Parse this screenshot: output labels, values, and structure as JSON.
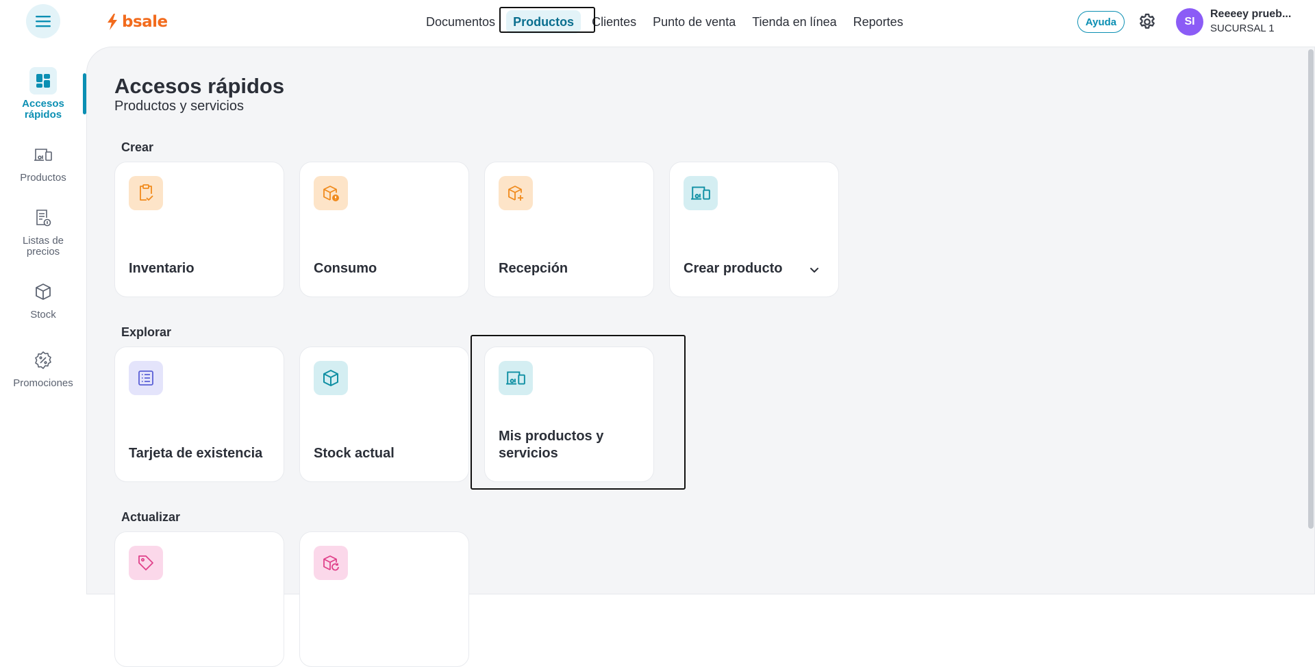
{
  "brand": {
    "name": "bsale",
    "color": "#f26b1d"
  },
  "topnav": {
    "items": [
      "Documentos",
      "Productos",
      "Clientes",
      "Punto de venta",
      "Tienda en línea",
      "Reportes"
    ],
    "active": "Productos"
  },
  "header": {
    "help_label": "Ayuda",
    "avatar_initials": "SI",
    "user_name": "Reeeey prueb...",
    "branch": "SUCURSAL 1"
  },
  "sidebar": {
    "items": [
      {
        "label": "Accesos rápidos",
        "icon": "dashboard-icon",
        "active": true
      },
      {
        "label": "Productos",
        "icon": "products-icon",
        "active": false
      },
      {
        "label": "Listas de precios",
        "icon": "price-list-icon",
        "active": false
      },
      {
        "label": "Stock",
        "icon": "box-icon",
        "active": false
      },
      {
        "label": "Promociones",
        "icon": "promo-badge-icon",
        "active": false
      }
    ]
  },
  "page": {
    "title": "Accesos rápidos",
    "subtitle": "Productos y servicios"
  },
  "sections": {
    "crear": {
      "title": "Crear",
      "cards": [
        {
          "label": "Inventario",
          "icon": "clipboard-check-icon",
          "color": "#fde4c8"
        },
        {
          "label": "Consumo",
          "icon": "box-alert-icon",
          "color": "#fde4c8"
        },
        {
          "label": "Recepción",
          "icon": "box-plus-icon",
          "color": "#fde4c8"
        },
        {
          "label": "Crear producto",
          "icon": "products-icon",
          "color": "#d4eef2",
          "dropdown": true
        }
      ]
    },
    "explorar": {
      "title": "Explorar",
      "cards": [
        {
          "label": "Tarjeta de existencia",
          "icon": "list-card-icon",
          "color": "#e4e4fb"
        },
        {
          "label": "Stock actual",
          "icon": "box-icon",
          "color": "#d4eef2"
        },
        {
          "label": "Mis productos y servicios",
          "icon": "products-icon",
          "color": "#d4eef2"
        }
      ]
    },
    "actualizar": {
      "title": "Actualizar",
      "cards": [
        {
          "label": "",
          "icon": "tag-icon",
          "color": "#fbd8ea"
        },
        {
          "label": "",
          "icon": "box-refresh-icon",
          "color": "#fbd8ea"
        }
      ]
    }
  }
}
